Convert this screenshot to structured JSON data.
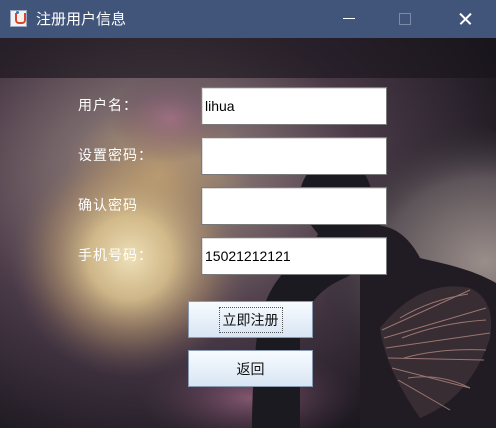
{
  "window": {
    "title": "注册用户信息",
    "icon": "java-cup-icon",
    "controls": [
      "minimize-icon",
      "maximize-icon",
      "close-icon"
    ]
  },
  "form": {
    "username": {
      "label": "用户名：",
      "value": "lihua"
    },
    "password": {
      "label": "设置密码：",
      "value": ""
    },
    "confirm": {
      "label": "确认密码",
      "value": ""
    },
    "phone": {
      "label": "手机号码：",
      "value": "15021212121"
    }
  },
  "buttons": {
    "register": "立即注册",
    "back": "返回"
  },
  "colors": {
    "titlebar": "#41557a",
    "button_top": "#f7fbff",
    "button_bottom": "#d8e5f3"
  }
}
